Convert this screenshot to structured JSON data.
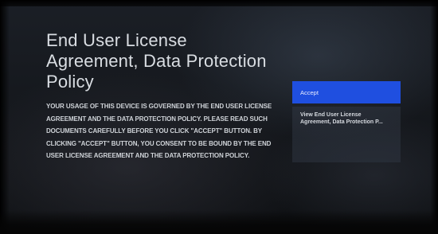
{
  "dialog": {
    "title": "End User License Agreement, Data Protection Policy",
    "body": "YOUR USAGE OF THIS DEVICE IS GOVERNED BY THE END USER LICENSE AGREEMENT AND THE DATA PROTECTION POLICY. PLEASE READ SUCH DOCUMENTS CAREFULLY BEFORE YOU CLICK \"ACCEPT\" BUTTON. BY CLICKING \"ACCEPT\" BUTTON, YOU CONSENT TO BE BOUND BY THE END USER LICENSE AGREEMENT AND THE DATA PROTECTION POLICY."
  },
  "actions": {
    "accept_label": "Accept",
    "view_label": "View End User License Agreement, Data Protection P..."
  },
  "colors": {
    "accent": "#1f4fe0",
    "text": "#d9dde2",
    "background": "#15181d"
  }
}
